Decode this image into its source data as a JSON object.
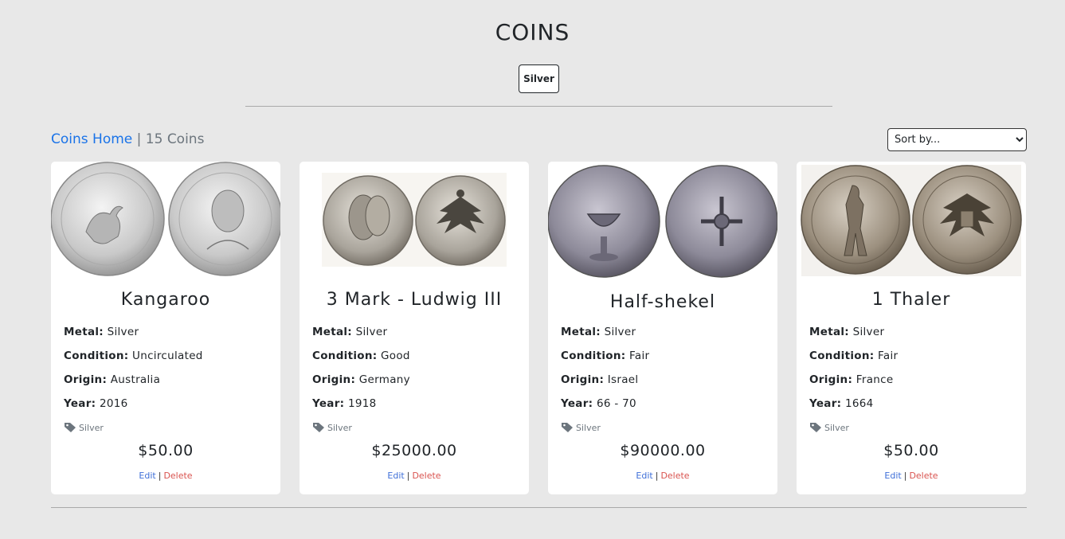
{
  "header": {
    "title": "COINS",
    "filter_badge": "Silver"
  },
  "breadcrumb": {
    "home_label": "Coins Home",
    "separator": "|",
    "count": "15 Coins"
  },
  "sort": {
    "selected": "Sort by..."
  },
  "labels": {
    "metal": "Metal:",
    "condition": "Condition:",
    "origin": "Origin:",
    "year": "Year:",
    "edit": "Edit",
    "divider": "|",
    "delete": "Delete"
  },
  "cards": [
    {
      "name": "Kangaroo",
      "metal": "Silver",
      "condition": "Uncirculated",
      "origin": "Australia",
      "year": "2016",
      "tag": "Silver",
      "price": "$50.00",
      "image": "silver-kangaroo-coin-image"
    },
    {
      "name": "3 Mark - Ludwig III",
      "metal": "Silver",
      "condition": "Good",
      "origin": "Germany",
      "year": "1918",
      "tag": "Silver",
      "price": "$25000.00",
      "image": "ludwig-3-mark-coin-image"
    },
    {
      "name": "Half-shekel",
      "metal": "Silver",
      "condition": "Fair",
      "origin": "Israel",
      "year": "66 - 70",
      "tag": "Silver",
      "price": "$90000.00",
      "image": "half-shekel-coin-image"
    },
    {
      "name": "1 Thaler",
      "metal": "Silver",
      "condition": "Fair",
      "origin": "France",
      "year": "1664",
      "tag": "Silver",
      "price": "$50.00",
      "image": "thaler-coin-image"
    }
  ],
  "colors": {
    "link": "#1a73e8",
    "edit": "#3f6fd8",
    "delete": "#d9534f",
    "background": "#e8e8e8"
  }
}
